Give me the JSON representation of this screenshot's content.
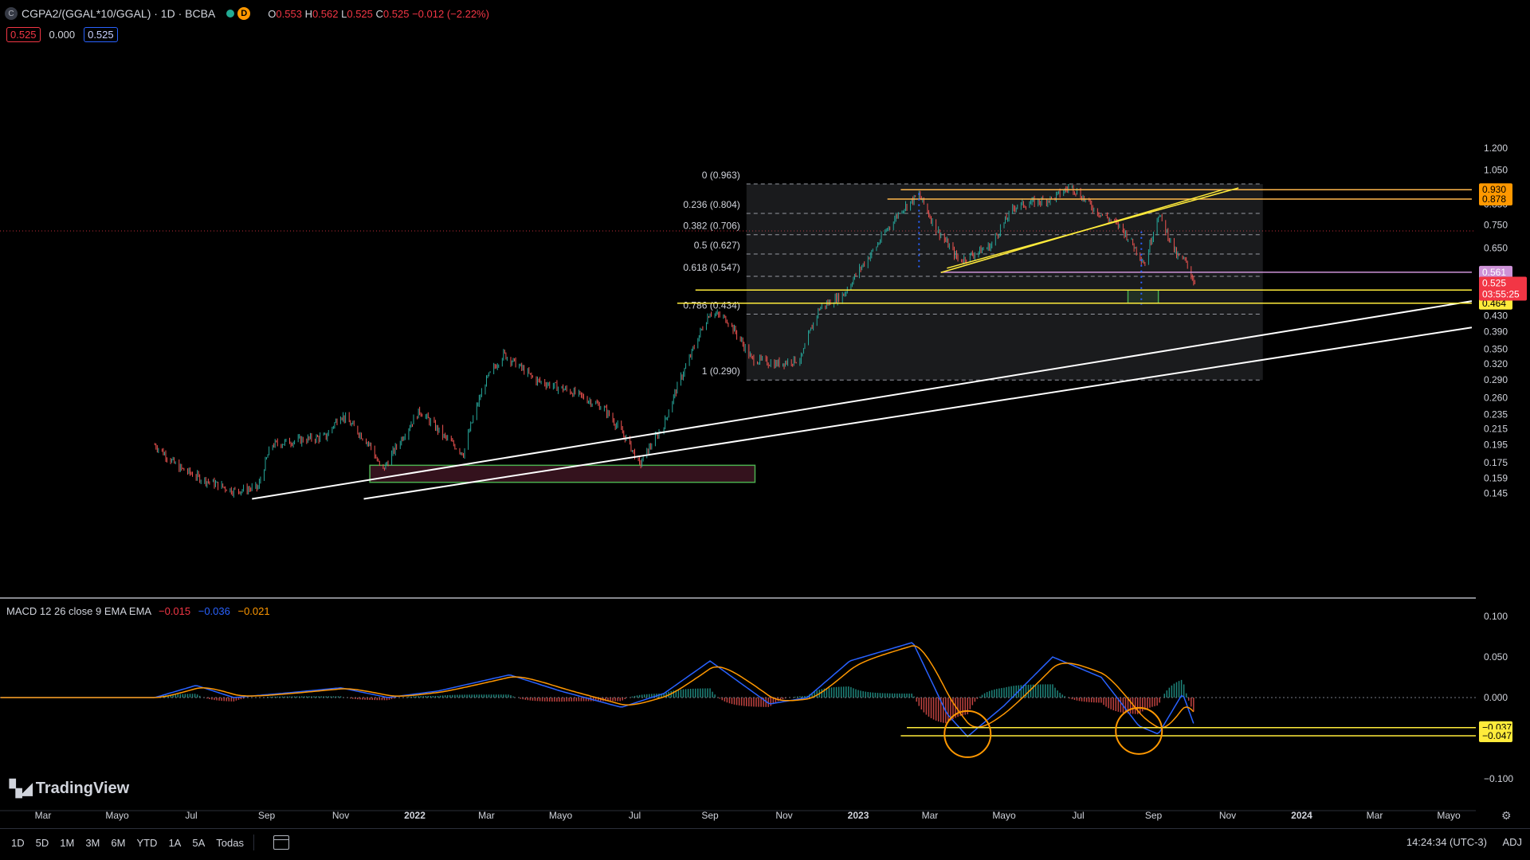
{
  "header": {
    "symbol_icon": "C",
    "symbol": "CGPA2/(GGAL*10/GGAL) · 1D · BCBA",
    "status_letter": "D",
    "o_label": "O",
    "o": "0.553",
    "h_label": "H",
    "h": "0.562",
    "l_label": "L",
    "l": "0.525",
    "c_label": "C",
    "c": "0.525",
    "change": "−0.012 (−2.22%)"
  },
  "badges": {
    "sell": "0.525",
    "spread": "0.000",
    "buy": "0.525"
  },
  "macd": {
    "label": "MACD 12 26 close 9 EMA EMA",
    "hist": "−0.015",
    "macd": "−0.036",
    "signal": "−0.021"
  },
  "logo": {
    "text": "TradingView",
    "icon": "tradingview-logo-icon"
  },
  "price_axis": {
    "ticks": [
      {
        "v": 1.2,
        "t": "1.200"
      },
      {
        "v": 1.05,
        "t": "1.050"
      },
      {
        "v": 0.85,
        "t": "0.850"
      },
      {
        "v": 0.75,
        "t": "0.750"
      },
      {
        "v": 0.65,
        "t": "0.650"
      },
      {
        "v": 0.43,
        "t": "0.430"
      },
      {
        "v": 0.39,
        "t": "0.390"
      },
      {
        "v": 0.35,
        "t": "0.350"
      },
      {
        "v": 0.32,
        "t": "0.320"
      },
      {
        "v": 0.29,
        "t": "0.290"
      },
      {
        "v": 0.26,
        "t": "0.260"
      },
      {
        "v": 0.235,
        "t": "0.235"
      },
      {
        "v": 0.215,
        "t": "0.215"
      },
      {
        "v": 0.195,
        "t": "0.195"
      },
      {
        "v": 0.175,
        "t": "0.175"
      },
      {
        "v": 0.159,
        "t": "0.159"
      },
      {
        "v": 0.145,
        "t": "0.145"
      }
    ],
    "labels": [
      {
        "v": 0.93,
        "t": "0.930",
        "bg": "#ff9800",
        "fg": "#000000"
      },
      {
        "v": 0.878,
        "t": "0.878",
        "bg": "#ff9800",
        "fg": "#000000"
      },
      {
        "v": 0.561,
        "t": "0.561",
        "bg": "#ce93d8",
        "fg": "#ffffff"
      },
      {
        "v": 0.503,
        "t": "0.503",
        "bg": "#ffeb3b",
        "fg": "#000000"
      },
      {
        "v": 0.464,
        "t": "0.464",
        "bg": "#ffeb3b",
        "fg": "#000000"
      }
    ],
    "last": {
      "v": 0.525,
      "t": "0.525",
      "countdown": "03:55:25",
      "bg": "#f23645"
    }
  },
  "macd_axis": {
    "ticks": [
      {
        "v": 0.1,
        "t": "0.100"
      },
      {
        "v": 0.05,
        "t": "0.050"
      },
      {
        "v": 0.0,
        "t": "0.000"
      },
      {
        "v": -0.1,
        "t": "−0.100"
      }
    ],
    "labels": [
      {
        "v": -0.037,
        "t": "−0.037",
        "bg": "#ffeb3b"
      },
      {
        "v": -0.047,
        "t": "−0.047",
        "bg": "#ffeb3b"
      }
    ]
  },
  "time_axis": {
    "ticks": [
      {
        "t": "Mar",
        "d": "2021-03-01",
        "bold": false
      },
      {
        "t": "Mayo",
        "d": "2021-05-01",
        "bold": false
      },
      {
        "t": "Jul",
        "d": "2021-07-01",
        "bold": false
      },
      {
        "t": "Sep",
        "d": "2021-09-01",
        "bold": false
      },
      {
        "t": "Nov",
        "d": "2021-11-01",
        "bold": false
      },
      {
        "t": "2022",
        "d": "2022-01-01",
        "bold": true
      },
      {
        "t": "Mar",
        "d": "2022-03-01",
        "bold": false
      },
      {
        "t": "Mayo",
        "d": "2022-05-01",
        "bold": false
      },
      {
        "t": "Jul",
        "d": "2022-07-01",
        "bold": false
      },
      {
        "t": "Sep",
        "d": "2022-09-01",
        "bold": false
      },
      {
        "t": "Nov",
        "d": "2022-11-01",
        "bold": false
      },
      {
        "t": "2023",
        "d": "2023-01-01",
        "bold": true
      },
      {
        "t": "Mar",
        "d": "2023-03-01",
        "bold": false
      },
      {
        "t": "Mayo",
        "d": "2023-05-01",
        "bold": false
      },
      {
        "t": "Jul",
        "d": "2023-07-01",
        "bold": false
      },
      {
        "t": "Sep",
        "d": "2023-09-01",
        "bold": false
      },
      {
        "t": "Nov",
        "d": "2023-11-01",
        "bold": false
      },
      {
        "t": "2024",
        "d": "2024-01-01",
        "bold": true
      },
      {
        "t": "Mar",
        "d": "2024-03-01",
        "bold": false
      },
      {
        "t": "Mayo",
        "d": "2024-05-01",
        "bold": false
      }
    ]
  },
  "fibonacci": {
    "start": "2022-10-01",
    "end": "2023-11-30",
    "levels": [
      {
        "t": "0 (0.963)",
        "v": 0.963
      },
      {
        "t": "0.236 (0.804)",
        "v": 0.804
      },
      {
        "t": "0.382 (0.706)",
        "v": 0.706
      },
      {
        "t": "0.5 (0.627)",
        "v": 0.627
      },
      {
        "t": "0.618 (0.547)",
        "v": 0.547
      },
      {
        "t": "0.786 (0.434)",
        "v": 0.434
      },
      {
        "t": "1 (0.290)",
        "v": 0.29
      }
    ]
  },
  "chart_data": {
    "type": "candlestick",
    "title": "CGPA2/(GGAL*10/GGAL) · 1D · BCBA",
    "y_scale": "log",
    "keypoints": [
      [
        "2021-01-15",
        0.12
      ],
      [
        "2021-05-20",
        0.13
      ],
      [
        "2021-06-01",
        0.195
      ],
      [
        "2021-06-20",
        0.17
      ],
      [
        "2021-07-10",
        0.158
      ],
      [
        "2021-08-05",
        0.147
      ],
      [
        "2021-08-25",
        0.15
      ],
      [
        "2021-09-05",
        0.195
      ],
      [
        "2021-09-25",
        0.2
      ],
      [
        "2021-10-20",
        0.205
      ],
      [
        "2021-11-01",
        0.235
      ],
      [
        "2021-11-25",
        0.195
      ],
      [
        "2021-12-05",
        0.165
      ],
      [
        "2021-12-20",
        0.2
      ],
      [
        "2022-01-05",
        0.24
      ],
      [
        "2022-01-25",
        0.205
      ],
      [
        "2022-02-10",
        0.185
      ],
      [
        "2022-03-01",
        0.29
      ],
      [
        "2022-03-15",
        0.34
      ],
      [
        "2022-04-10",
        0.29
      ],
      [
        "2022-05-10",
        0.27
      ],
      [
        "2022-06-05",
        0.245
      ],
      [
        "2022-06-25",
        0.2
      ],
      [
        "2022-07-05",
        0.172
      ],
      [
        "2022-07-25",
        0.22
      ],
      [
        "2022-08-15",
        0.33
      ],
      [
        "2022-09-01",
        0.44
      ],
      [
        "2022-09-15",
        0.42
      ],
      [
        "2022-10-05",
        0.33
      ],
      [
        "2022-10-25",
        0.32
      ],
      [
        "2022-11-15",
        0.33
      ],
      [
        "2022-11-30",
        0.45
      ],
      [
        "2022-12-20",
        0.49
      ],
      [
        "2023-01-15",
        0.65
      ],
      [
        "2023-02-05",
        0.82
      ],
      [
        "2023-02-20",
        0.9
      ],
      [
        "2023-03-05",
        0.74
      ],
      [
        "2023-03-25",
        0.6
      ],
      [
        "2023-04-20",
        0.66
      ],
      [
        "2023-05-10",
        0.84
      ],
      [
        "2023-06-10",
        0.88
      ],
      [
        "2023-06-25",
        0.95
      ],
      [
        "2023-07-15",
        0.82
      ],
      [
        "2023-08-05",
        0.74
      ],
      [
        "2023-08-25",
        0.59
      ],
      [
        "2023-09-05",
        0.8
      ],
      [
        "2023-09-20",
        0.62
      ],
      [
        "2023-09-27",
        0.6
      ],
      [
        "2023-10-05",
        0.525
      ]
    ],
    "macd_keypoints": [
      [
        "2021-01-15",
        0.0
      ],
      [
        "2021-06-01",
        0.0
      ],
      [
        "2021-07-05",
        0.015
      ],
      [
        "2021-08-05",
        0.0
      ],
      [
        "2021-09-20",
        0.006
      ],
      [
        "2021-11-01",
        0.012
      ],
      [
        "2021-12-10",
        0.0
      ],
      [
        "2022-01-20",
        0.008
      ],
      [
        "2022-03-20",
        0.028
      ],
      [
        "2022-05-01",
        0.008
      ],
      [
        "2022-06-20",
        -0.012
      ],
      [
        "2022-07-25",
        0.005
      ],
      [
        "2022-09-01",
        0.045
      ],
      [
        "2022-10-20",
        -0.008
      ],
      [
        "2022-11-20",
        0.0
      ],
      [
        "2022-12-25",
        0.045
      ],
      [
        "2023-02-15",
        0.068
      ],
      [
        "2023-03-15",
        -0.02
      ],
      [
        "2023-04-01",
        -0.048
      ],
      [
        "2023-05-01",
        -0.01
      ],
      [
        "2023-06-10",
        0.05
      ],
      [
        "2023-07-20",
        0.025
      ],
      [
        "2023-08-20",
        -0.035
      ],
      [
        "2023-09-05",
        -0.045
      ],
      [
        "2023-09-25",
        0.005
      ],
      [
        "2023-10-05",
        -0.036
      ]
    ]
  }
}
